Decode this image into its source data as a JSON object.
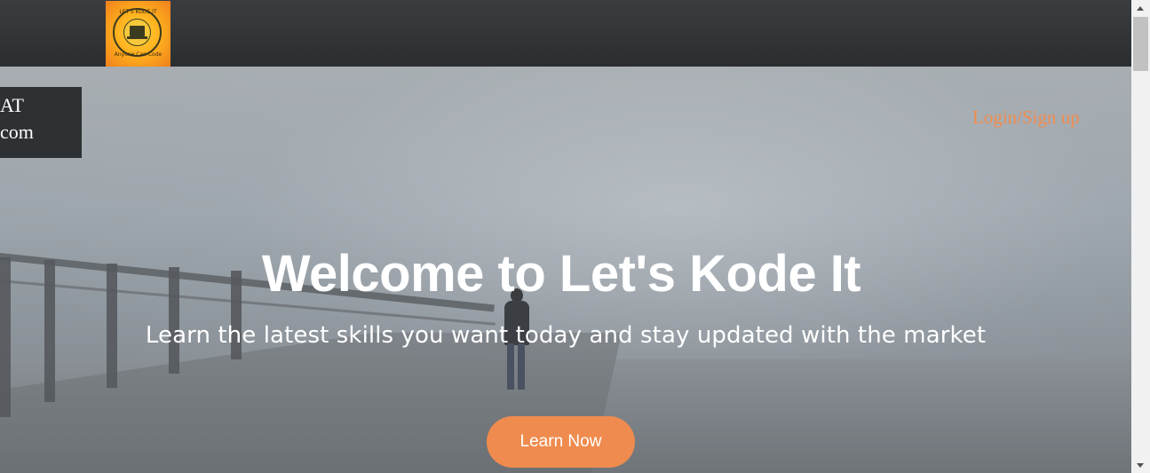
{
  "header": {
    "logo": {
      "top_text": "LET'S KODE IT",
      "bottom_text": "Anyone Can Code",
      "colors": {
        "outer": "#f07f1c",
        "inner": "#ffd23a"
      }
    }
  },
  "side_box": {
    "line1": "AT",
    "line2": "com"
  },
  "nav": {
    "login_label": "Login/Sign up"
  },
  "hero": {
    "title": "Welcome to Let's Kode It",
    "subtitle": "Learn the latest skills you want today and stay updated with the market",
    "cta_label": "Learn Now"
  },
  "colors": {
    "accent": "#ef8b4e",
    "topbar": "#2e3133"
  },
  "icons": {
    "scroll_up": "scroll-up-arrow-icon",
    "scroll_down": "scroll-down-arrow-icon"
  }
}
